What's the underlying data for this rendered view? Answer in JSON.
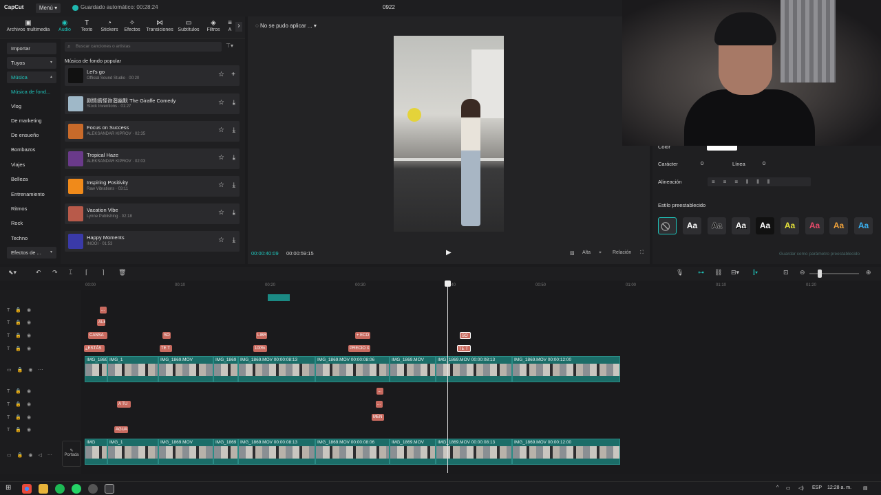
{
  "app": {
    "logo": "CapCut",
    "menu_label": "Menú",
    "autosave": "Guardado automático: 00:28:24",
    "project_title": "0922"
  },
  "toolbar": {
    "items": [
      {
        "label": "Archivos multimedia",
        "icon": "media-icon"
      },
      {
        "label": "Audio",
        "icon": "audio-icon"
      },
      {
        "label": "Texto",
        "icon": "text-icon"
      },
      {
        "label": "Stickers",
        "icon": "sticker-icon"
      },
      {
        "label": "Efectos",
        "icon": "effects-icon"
      },
      {
        "label": "Transiciones",
        "icon": "transitions-icon"
      },
      {
        "label": "Subtítulos",
        "icon": "subtitles-icon"
      },
      {
        "label": "Filtros",
        "icon": "filters-icon"
      },
      {
        "label": "A",
        "icon": "adjust-icon"
      }
    ],
    "active": "Audio"
  },
  "sidebar": {
    "items": [
      {
        "label": "Importar"
      },
      {
        "label": "Tuyos"
      },
      {
        "label": "Música"
      },
      {
        "label": "Música de fond..."
      },
      {
        "label": "Vlog"
      },
      {
        "label": "De marketing"
      },
      {
        "label": "De ensueño"
      },
      {
        "label": "Bombazos"
      },
      {
        "label": "Viajes"
      },
      {
        "label": "Belleza"
      },
      {
        "label": "Entrenamiento"
      },
      {
        "label": "Ritmos"
      },
      {
        "label": "Rock"
      },
      {
        "label": "Techno"
      },
      {
        "label": "Efectos de ..."
      }
    ]
  },
  "music": {
    "search_placeholder": "Buscar canciones o artistas",
    "section_title": "Música de fondo popular",
    "tracks": [
      {
        "title": "Let's go",
        "sub": "Official Sound Studio · 00:20",
        "color": "#111111"
      },
      {
        "title": "剧情搞怪诙谐幽默 The Giraffe Comedy",
        "sub": "Stock Inventions · 01:27",
        "color": "#9fb8c8"
      },
      {
        "title": "Focus on Success",
        "sub": "ALEKSANDAR KIPROV · 02:35",
        "color": "#c86a2a"
      },
      {
        "title": "Tropical Haze",
        "sub": "ALEKSANDAR KIPROV · 02:03",
        "color": "#6a3a8a"
      },
      {
        "title": "Inspiring Positivity",
        "sub": "Raw Vibrations · 03:11",
        "color": "#f08a1a"
      },
      {
        "title": "Vacation Vibe",
        "sub": "Lynne Publishing · 02:18",
        "color": "#b85a4a"
      },
      {
        "title": "Happy Moments",
        "sub": "INOOI · 01:53",
        "color": "#3a3aa8"
      }
    ]
  },
  "player": {
    "status": "No se pudo aplicar ...",
    "current_time": "00:00:40:09",
    "total_time": "00:00:59:15",
    "controls": {
      "alta": "Alta",
      "relacion": "Relación"
    }
  },
  "text_panel": {
    "color_label": "Color",
    "caracter_label": "Carácter",
    "caracter_value": "0",
    "linea_label": "Línea",
    "linea_value": "0",
    "alineacion_label": "Alineación",
    "preset_title": "Estilo preestablecido",
    "preset_glyph": "Aa",
    "save_preset": "Guardar como parámetro preestablecido"
  },
  "ruler": {
    "ticks": [
      "00:00",
      "00:10",
      "00:20",
      "00:30",
      "00:40",
      "00:50",
      "01:00",
      "01:10",
      "01:20"
    ]
  },
  "timeline": {
    "text_clips": [
      {
        "label": "...",
        "row": 0
      },
      {
        "label": "ALE",
        "row": 1
      },
      {
        "label": "CANSA",
        "row": 2
      },
      {
        "label": "SO",
        "row": 2
      },
      {
        "label": "LIBR",
        "row": 2
      },
      {
        "label": "+ ECO",
        "row": 2
      },
      {
        "label": "SO",
        "row": 2
      },
      {
        "label": "¿ESTÁS",
        "row": 3
      },
      {
        "label": "TE T",
        "row": 3
      },
      {
        "label": "100%",
        "row": 3
      },
      {
        "label": "PRECIO X",
        "row": 3
      },
      {
        "label": "TE T",
        "row": 3
      },
      {
        "label": "A TU",
        "row": 6
      },
      {
        "label": "...",
        "row": 5
      },
      {
        "label": "...",
        "row": 6
      },
      {
        "label": "MEN",
        "row": 7
      },
      {
        "label": "AGUA",
        "row": 8
      }
    ],
    "video_labels": [
      "IMG_1869",
      "IMG_1",
      "IMG_1869.MOV",
      "IMG_1869",
      "IMG_1869.MOV 00:00:08:13",
      "IMG_1869.MOV 00:00:08:06",
      "IMG_1869.MOV",
      "IMG_1869.MOV 00:00:08:13",
      "IMG_1869.MOV 00:00:12:00"
    ],
    "main_labels": [
      "IMG",
      "IMG_1",
      "IMG_1869.MOV",
      "IMG_1869",
      "IMG_1869.MOV 00:00:08:13",
      "IMG_1869.MOV 00:00:08:06",
      "IMG_1869.MOV",
      "IMG_1869.MOV 00:00:08:13",
      "IMG_1869.MOV 00:00:12:00"
    ],
    "portada_label": "Portada"
  },
  "taskbar": {
    "lang": "ESP",
    "clock": "12:28 a. m."
  }
}
